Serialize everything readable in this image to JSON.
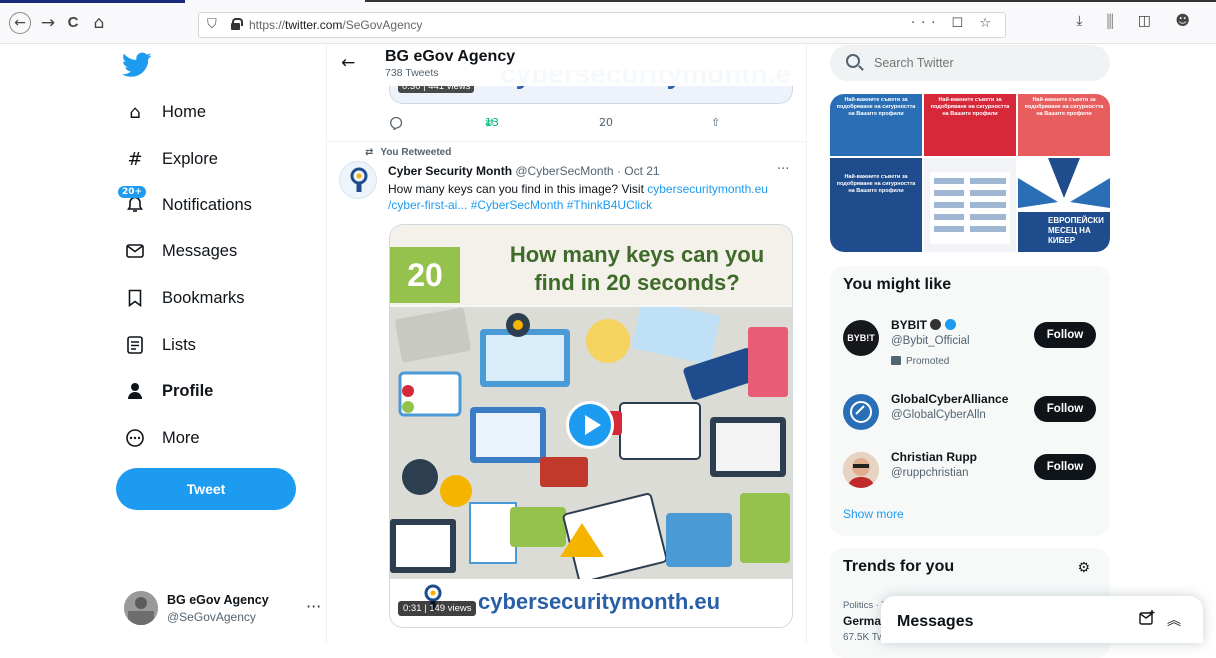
{
  "browser": {
    "url_prefix": "https://",
    "url_host": "twitter.com",
    "url_path": "/SeGovAgency",
    "nav_back": "←",
    "nav_forward": "→",
    "nav_reload": "C",
    "nav_home": "⌂",
    "url_tools": "··· ☐ ☆",
    "right_tools": "⤓ ⫼ ◫ ☻"
  },
  "sidebar": {
    "items": [
      {
        "label": "Home",
        "icon": "home-icon",
        "glyph": "⌂"
      },
      {
        "label": "Explore",
        "icon": "hashtag-icon",
        "glyph": "#"
      },
      {
        "label": "Notifications",
        "icon": "bell-icon",
        "glyph": "🔔",
        "badge": "20+"
      },
      {
        "label": "Messages",
        "icon": "envelope-icon",
        "glyph": "✉"
      },
      {
        "label": "Bookmarks",
        "icon": "bookmark-icon",
        "glyph": "⚐"
      },
      {
        "label": "Lists",
        "icon": "list-icon",
        "glyph": "☰"
      },
      {
        "label": "Profile",
        "icon": "person-icon",
        "glyph": "●"
      },
      {
        "label": "More",
        "icon": "more-circle-icon",
        "glyph": "⋯"
      }
    ],
    "tweet_button": "Tweet",
    "account": {
      "name": "BG eGov Agency",
      "handle": "@SeGovAgency",
      "more": "···"
    }
  },
  "header": {
    "back": "←",
    "title": "BG eGov Agency",
    "subtitle": "738 Tweets"
  },
  "prev_tweet": {
    "media_text": "cybersecuritymonth.eu",
    "duration": "0:30 | 441 views",
    "actions": {
      "reply": "",
      "retweets": "13",
      "likes": "20"
    }
  },
  "tweet": {
    "retweet_label": "You Retweeted",
    "author_name": "Cyber Security Month",
    "author_handle": "@CyberSecMonth · Oct 21",
    "text_prefix": "How many keys can you find in this image? Visit ",
    "text_link": "cybersecuritymonth.eu /cyber-first-ai...",
    "text_tags": "#CyberSecMonth #ThinkB4UClick",
    "more": "···",
    "media": {
      "number": "20",
      "question": "How many keys can you find in 20 seconds?",
      "brand": "cybersecuritymonth.eu",
      "duration": "0:31 | 149 views"
    }
  },
  "right": {
    "search_placeholder": "Search Twitter",
    "gallery_text": "Най-важните съвети за подобряване на сигурността на Вашите профили",
    "gallery_poster": "ЕВРОПЕЙСКИ МЕСЕЦ НА КИБЕР",
    "who_to_follow": {
      "title": "You might like",
      "users": [
        {
          "name": "BYBIT",
          "handle": "@Bybit_Official",
          "promoted": "Promoted",
          "follow": "Follow",
          "avatar_text": "BYB!T"
        },
        {
          "name": "GlobalCyberAlliance",
          "handle": "@GlobalCyberAlln",
          "promoted": "",
          "follow": "Follow",
          "avatar_text": ""
        },
        {
          "name": "Christian Rupp",
          "handle": "@ruppchristian",
          "promoted": "",
          "follow": "Follow",
          "avatar_text": ""
        }
      ],
      "show_more": "Show more"
    },
    "trends": {
      "title": "Trends for you",
      "category": "Politics · Tr",
      "name": "Germai",
      "count": "67.5K Tw"
    }
  },
  "messages_drawer": {
    "title": "Messages"
  },
  "colors": {
    "accent": "#1d9bf0",
    "text": "#0f1419",
    "muted": "#536471"
  }
}
